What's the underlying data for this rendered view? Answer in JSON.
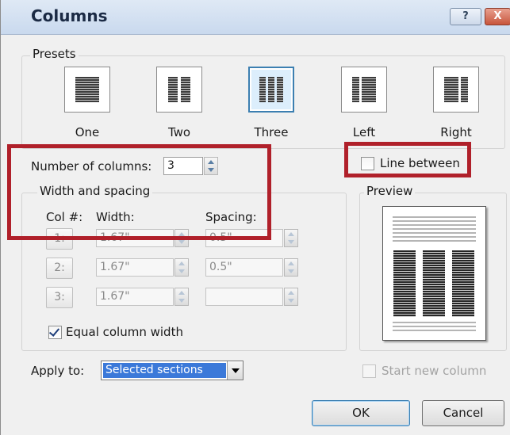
{
  "dialog": {
    "title": "Columns",
    "help_label": "?",
    "close_label": "X"
  },
  "presets": {
    "group_label": "Presets",
    "items": [
      {
        "label": "One",
        "selected": false
      },
      {
        "label": "Two",
        "selected": false
      },
      {
        "label": "Three",
        "selected": true
      },
      {
        "label": "Left",
        "selected": false
      },
      {
        "label": "Right",
        "selected": false
      }
    ]
  },
  "num_columns": {
    "label": "Number of columns:",
    "value": "3"
  },
  "line_between": {
    "label": "Line between",
    "checked": false
  },
  "width_spacing": {
    "group_label": "Width and spacing",
    "col_header": "Col #:",
    "width_header": "Width:",
    "spacing_header": "Spacing:",
    "rows": [
      {
        "col": "1:",
        "width": "1.67\"",
        "spacing": "0.5\""
      },
      {
        "col": "2:",
        "width": "1.67\"",
        "spacing": "0.5\""
      },
      {
        "col": "3:",
        "width": "1.67\"",
        "spacing": ""
      }
    ]
  },
  "equal_width": {
    "label": "Equal column width",
    "checked": true
  },
  "preview": {
    "label": "Preview"
  },
  "apply_to": {
    "label": "Apply to:",
    "value": "Selected sections"
  },
  "start_new_column": {
    "label": "Start new column",
    "checked": false
  },
  "buttons": {
    "ok": "OK",
    "cancel": "Cancel"
  },
  "colors": {
    "highlight_box": "#b0202a",
    "selected_preset": "#3c7fb1",
    "dropdown_selection": "#3b79d9"
  }
}
